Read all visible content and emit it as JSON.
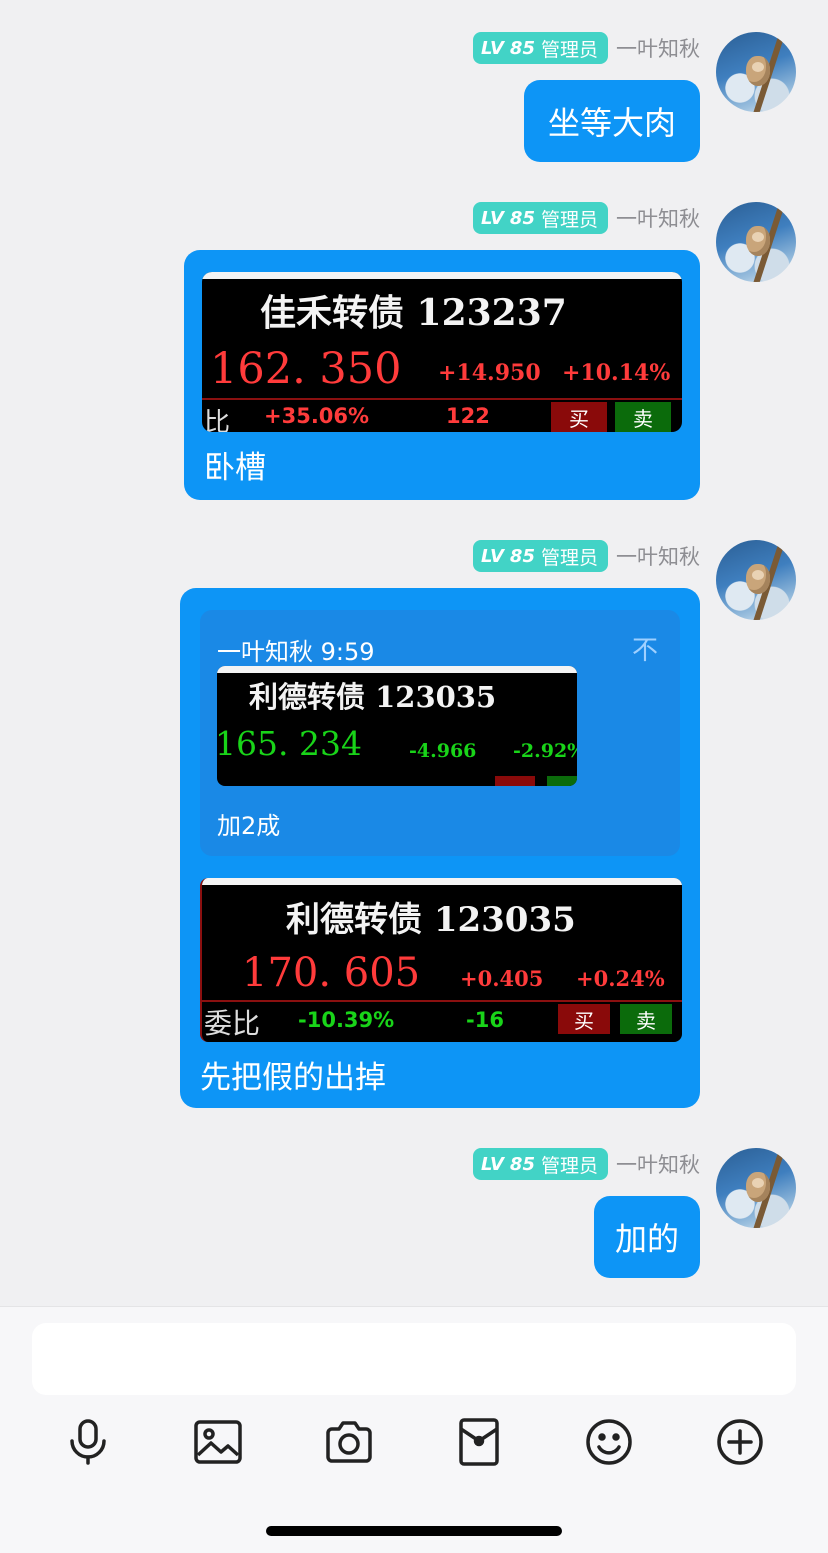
{
  "user": {
    "level": "LV",
    "level_num": "85",
    "role": "管理员",
    "name": "一叶知秋"
  },
  "messages": [
    {
      "type": "text",
      "text": "坐等大肉"
    },
    {
      "type": "image",
      "caption": "卧槽",
      "quote": {
        "title": "佳禾转债 123237",
        "price": "162. 350",
        "change": "+14.950",
        "pct": "+10.14%",
        "label": "比",
        "ratio": "+35.06%",
        "diff": "122",
        "buy": "买",
        "sell": "卖"
      }
    },
    {
      "type": "reply",
      "reply_header": "一叶知秋 9:59",
      "reply_pin": "不",
      "reply_caption": "加2成",
      "reply_quote": {
        "title": "利德转债 123035",
        "price": "165. 234",
        "change": "-4.966",
        "pct": "-2.92%"
      },
      "caption": "先把假的出掉",
      "quote": {
        "title": "利德转债 123035",
        "price": "170. 605",
        "change": "+0.405",
        "pct": "+0.24%",
        "label": "委比",
        "ratio": "-10.39%",
        "diff": "-16",
        "buy": "买",
        "sell": "卖"
      }
    },
    {
      "type": "text",
      "text": "加的"
    }
  ],
  "toolbar": [
    "microphone-icon",
    "image-icon",
    "camera-icon",
    "red-packet-icon",
    "emoji-icon",
    "add-icon"
  ],
  "colors": {
    "bubble": "#0d95f6",
    "badge": "#42d3c6",
    "price_up": "#ff3b3b",
    "price_down": "#19d419"
  }
}
